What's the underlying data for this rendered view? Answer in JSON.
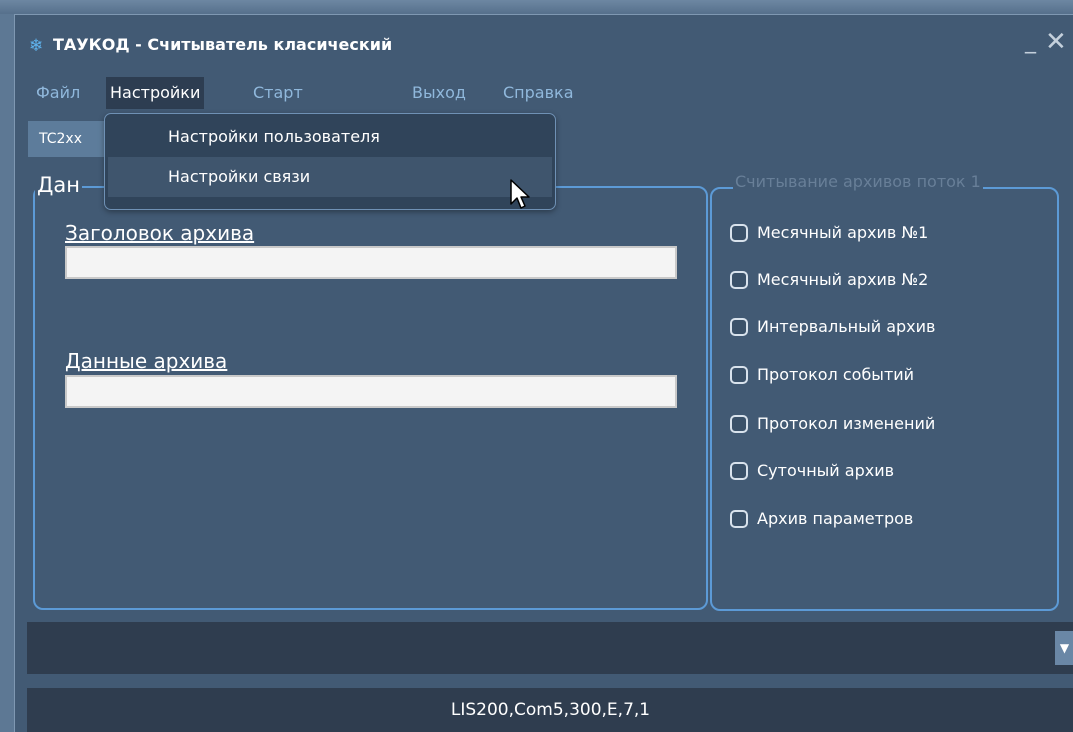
{
  "window": {
    "title": "ТАУКОД - Считыватель класический",
    "minimize_glyph": "_",
    "close_glyph": "✕"
  },
  "menu": [
    {
      "label": "Файл"
    },
    {
      "label": "Настройки",
      "active": true
    },
    {
      "label": "Старт"
    },
    {
      "label": "Выход"
    },
    {
      "label": "Справка"
    }
  ],
  "device_tab": {
    "label": "TC2xx"
  },
  "dropdown": {
    "items": [
      "Настройки пользователя",
      "Настройки связи"
    ],
    "highlighted": "Настройки связи"
  },
  "data_group": {
    "title": "Дан",
    "header_label": "Заголовок архива",
    "header_value": "",
    "data_label": "Данные архива",
    "data_value": ""
  },
  "read_group": {
    "title": "Считывание архивов поток 1",
    "checkboxes": [
      {
        "label": "Месячный архив №1",
        "checked": false
      },
      {
        "label": "Месячный архив №2",
        "checked": false
      },
      {
        "label": "Интервальный архив",
        "checked": false
      },
      {
        "label": "Протокол событий",
        "checked": false
      },
      {
        "label": "Протокол изменений",
        "checked": false
      },
      {
        "label": "Суточный архив",
        "checked": false
      },
      {
        "label": "Архив параметров",
        "checked": false
      }
    ]
  },
  "combo": {
    "value": "",
    "arrow": "▼"
  },
  "status": {
    "text": "LIS200,Com5,300,E,7,1"
  },
  "colors": {
    "window_bg": "#425a74",
    "group_border": "#5c9ad6",
    "menu_text": "#90b8dc",
    "status_bg": "#2f3d4f"
  },
  "icons": {
    "app": "snowflake-icon",
    "cursor": "mouse-pointer-icon"
  }
}
